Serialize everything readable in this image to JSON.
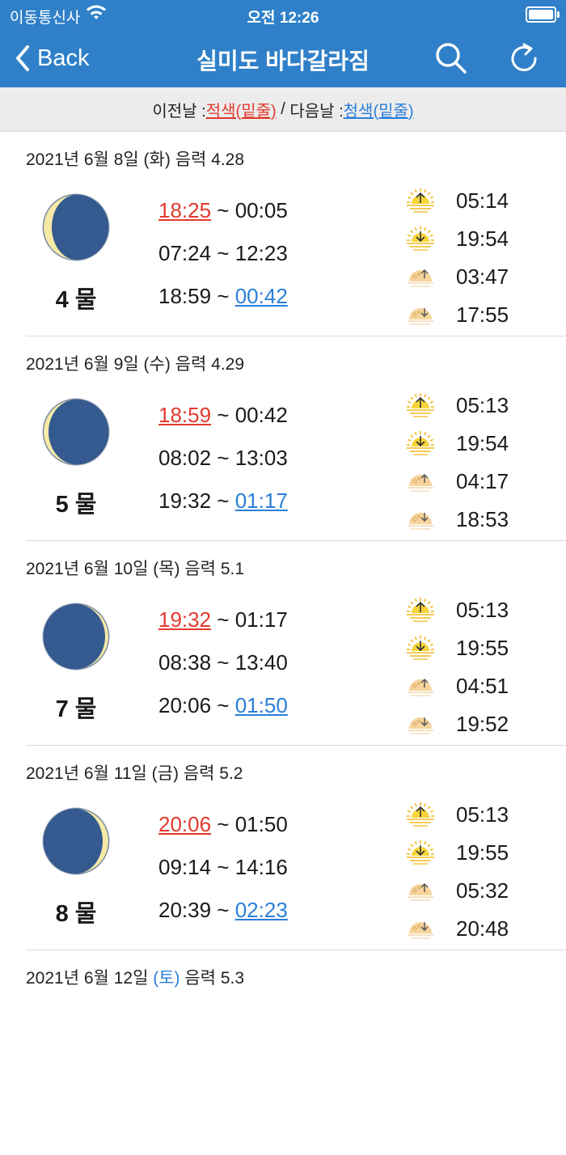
{
  "status": {
    "carrier": "이동통신사",
    "time": "오전 12:26"
  },
  "nav": {
    "back_label": "Back",
    "title": "실미도 바다갈라짐"
  },
  "legend": {
    "prev_label": "이전날 : ",
    "prev_value": "적색(밑줄)",
    "sep": " / ",
    "next_label": "다음날 : ",
    "next_value": "청색(밑줄)"
  },
  "colors": {
    "header": "#2f80c8",
    "prev_red": "#e23a2e",
    "next_blue": "#2a7fd9",
    "moon": "#345a8f"
  },
  "days": [
    {
      "date_main": "2021년 6월 8일 ",
      "weekday": "(화)",
      "lunar": " 음력 4.28",
      "mul": "4 물",
      "moon_phase": "waning-crescent",
      "tides": [
        {
          "start": "18:25",
          "end": "00:05"
        },
        {
          "start": "07:24",
          "end": "12:23"
        },
        {
          "start": "18:59",
          "end": "00:42"
        }
      ],
      "astro": [
        "05:14",
        "19:54",
        "03:47",
        "17:55"
      ]
    },
    {
      "date_main": "2021년 6월 9일 ",
      "weekday": "(수)",
      "lunar": " 음력 4.29",
      "mul": "5 물",
      "moon_phase": "waning-thin",
      "tides": [
        {
          "start": "18:59",
          "end": "00:42"
        },
        {
          "start": "08:02",
          "end": "13:03"
        },
        {
          "start": "19:32",
          "end": "01:17"
        }
      ],
      "astro": [
        "05:13",
        "19:54",
        "04:17",
        "18:53"
      ]
    },
    {
      "date_main": "2021년 6월 10일 ",
      "weekday": "(목)",
      "lunar": " 음력 5.1",
      "mul": "7 물",
      "moon_phase": "waxing-thin",
      "tides": [
        {
          "start": "19:32",
          "end": "01:17"
        },
        {
          "start": "08:38",
          "end": "13:40"
        },
        {
          "start": "20:06",
          "end": "01:50"
        }
      ],
      "astro": [
        "05:13",
        "19:55",
        "04:51",
        "19:52"
      ]
    },
    {
      "date_main": "2021년 6월 11일 ",
      "weekday": "(금)",
      "lunar": " 음력 5.2",
      "mul": "8 물",
      "moon_phase": "waxing-crescent",
      "tides": [
        {
          "start": "20:06",
          "end": "01:50"
        },
        {
          "start": "09:14",
          "end": "14:16"
        },
        {
          "start": "20:39",
          "end": "02:23"
        }
      ],
      "astro": [
        "05:13",
        "19:55",
        "05:32",
        "20:48"
      ]
    },
    {
      "date_main": "2021년 6월 12일 ",
      "weekday": "(토)",
      "lunar": " 음력 5.3"
    }
  ],
  "icons": [
    "sunrise-icon",
    "sunset-icon",
    "moonrise-icon",
    "moonset-icon"
  ]
}
